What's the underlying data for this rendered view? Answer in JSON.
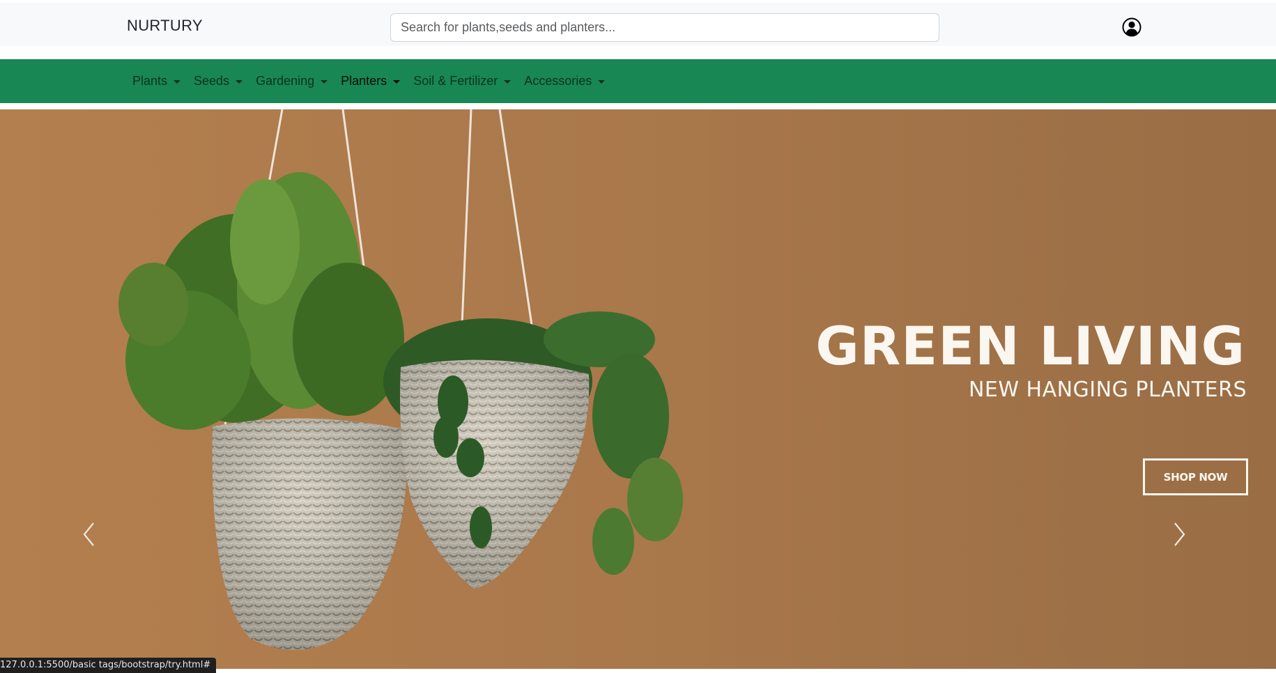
{
  "header": {
    "brand": "NURTURY",
    "search_placeholder": "Search for plants,seeds and planters...",
    "account_icon": "user-circle-icon"
  },
  "nav": {
    "items": [
      {
        "label": "Plants"
      },
      {
        "label": "Seeds"
      },
      {
        "label": "Gardening"
      },
      {
        "label": "Planters"
      },
      {
        "label": "Soil & Fertilizer"
      },
      {
        "label": "Accessories"
      }
    ],
    "active_item": "Planters",
    "background_color": "#198754"
  },
  "hero": {
    "headline": "GREEN LIVING",
    "subheadline": "NEW HANGING PLANTERS",
    "cta_label": "SHOP NOW",
    "prev_icon": "chevron-left-icon",
    "next_icon": "chevron-right-icon",
    "background_color": "#a9784b",
    "text_color": "#fbf7f0"
  },
  "status_bar": {
    "url": "127.0.0.1:5500/basic tags/bootstrap/try.html#"
  }
}
